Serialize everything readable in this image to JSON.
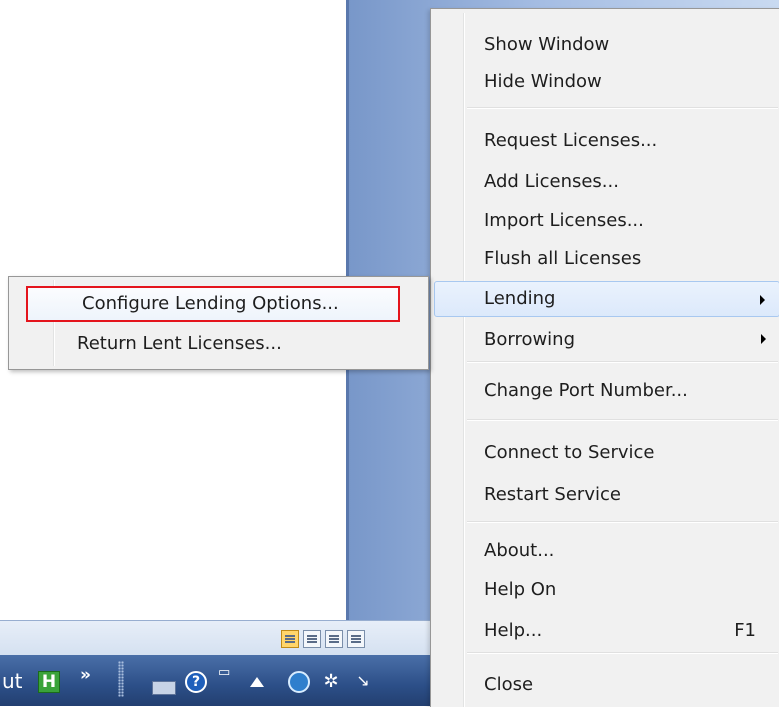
{
  "context_menu": {
    "items": [
      {
        "label": "Show Window"
      },
      {
        "label": "Hide Window"
      },
      {
        "label": "Request Licenses..."
      },
      {
        "label": "Add Licenses..."
      },
      {
        "label": "Import Licenses..."
      },
      {
        "label": "Flush all Licenses"
      },
      {
        "label": "Lending"
      },
      {
        "label": "Borrowing"
      },
      {
        "label": "Change Port Number..."
      },
      {
        "label": "Connect to Service"
      },
      {
        "label": "Restart Service"
      },
      {
        "label": "About..."
      },
      {
        "label": "Help On"
      },
      {
        "label": "Help...",
        "shortcut": "F1"
      },
      {
        "label": "Close"
      }
    ]
  },
  "lending_submenu": {
    "items": [
      {
        "label": "Configure Lending Options..."
      },
      {
        "label": "Return Lent Licenses..."
      }
    ]
  },
  "taskbar": {
    "partial_text": "ut",
    "h_icon_letter": "H",
    "overflow_chevron": "»"
  },
  "colors": {
    "highlight_outline": "#e4141c",
    "menu_background": "#f1f1f1",
    "taskbar_blue": "#2c4f88"
  }
}
